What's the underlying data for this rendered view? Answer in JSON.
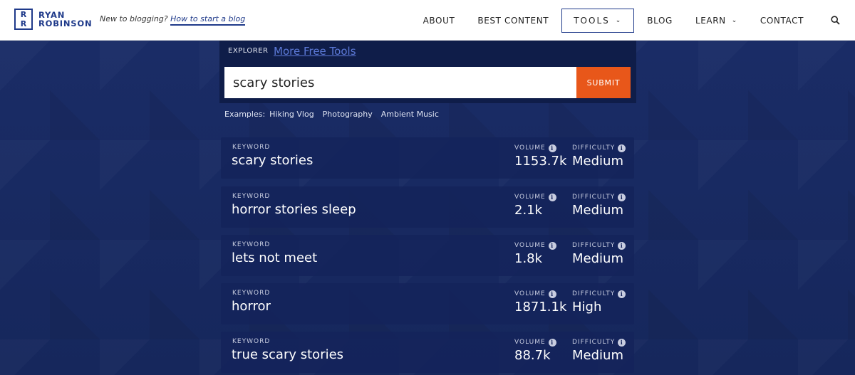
{
  "header": {
    "logo_line1": "RYAN",
    "logo_line2": "ROBINSON",
    "logo_mark": "R R",
    "tagline_prefix": "New to blogging?",
    "tagline_link": "How to start a blog",
    "nav": [
      {
        "label": "ABOUT"
      },
      {
        "label": "BEST CONTENT"
      },
      {
        "label": "TOOLS"
      },
      {
        "label": "BLOG"
      },
      {
        "label": "LEARN"
      },
      {
        "label": "CONTACT"
      }
    ],
    "search_icon": "search-icon"
  },
  "explorer": {
    "label": "EXPLORER",
    "more_tools": "More Free Tools",
    "search_value": "scary stories",
    "submit_label": "SUBMIT",
    "examples_label": "Examples:",
    "examples": [
      "Hiking Vlog",
      "Photography",
      "Ambient Music"
    ]
  },
  "results_labels": {
    "keyword": "KEYWORD",
    "volume": "VOLUME",
    "difficulty": "DIFFICULTY"
  },
  "results": [
    {
      "keyword": "scary stories",
      "volume": "1153.7k",
      "difficulty": "Medium"
    },
    {
      "keyword": "horror stories sleep",
      "volume": "2.1k",
      "difficulty": "Medium"
    },
    {
      "keyword": "lets not meet",
      "volume": "1.8k",
      "difficulty": "Medium"
    },
    {
      "keyword": "horror",
      "volume": "1871.1k",
      "difficulty": "High"
    },
    {
      "keyword": "true scary stories",
      "volume": "88.7k",
      "difficulty": "Medium"
    }
  ],
  "colors": {
    "brand": "#1f3a8a",
    "accent": "#e8571a",
    "background": "#17285e"
  }
}
